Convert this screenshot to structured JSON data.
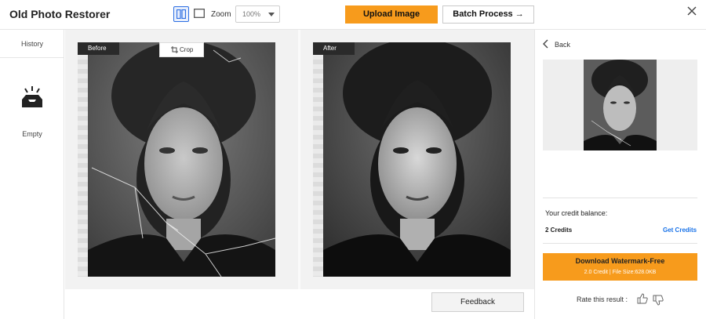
{
  "header": {
    "app_title": "Old Photo Restorer",
    "zoom_label": "Zoom",
    "zoom_value": "100%",
    "upload_label": "Upload Image",
    "batch_label": "Batch Process →"
  },
  "sidebar": {
    "history_label": "History",
    "empty_label": "Empty"
  },
  "compare": {
    "before_label": "Before",
    "after_label": "After",
    "crop_label": "Crop"
  },
  "footer": {
    "feedback_label": "Feedback"
  },
  "panel": {
    "back_label": "Back",
    "credit_balance_label": "Your credit balance:",
    "credits_value": "2 Credits",
    "get_credits_label": "Get Credits",
    "download_label": "Download Watermark-Free",
    "download_info": "2.0 Credit | File Size:628.0KB",
    "rate_label": "Rate this result :"
  },
  "colors": {
    "accent_orange": "#f79b1c",
    "link_blue": "#1a73e8",
    "active_view_blue": "#2d6fe3"
  },
  "icons": [
    "split-view-icon",
    "single-view-icon",
    "chevron-down-icon",
    "close-icon",
    "inbox-icon",
    "crop-icon",
    "chevron-left-icon",
    "thumbs-up-icon",
    "thumbs-down-icon"
  ]
}
